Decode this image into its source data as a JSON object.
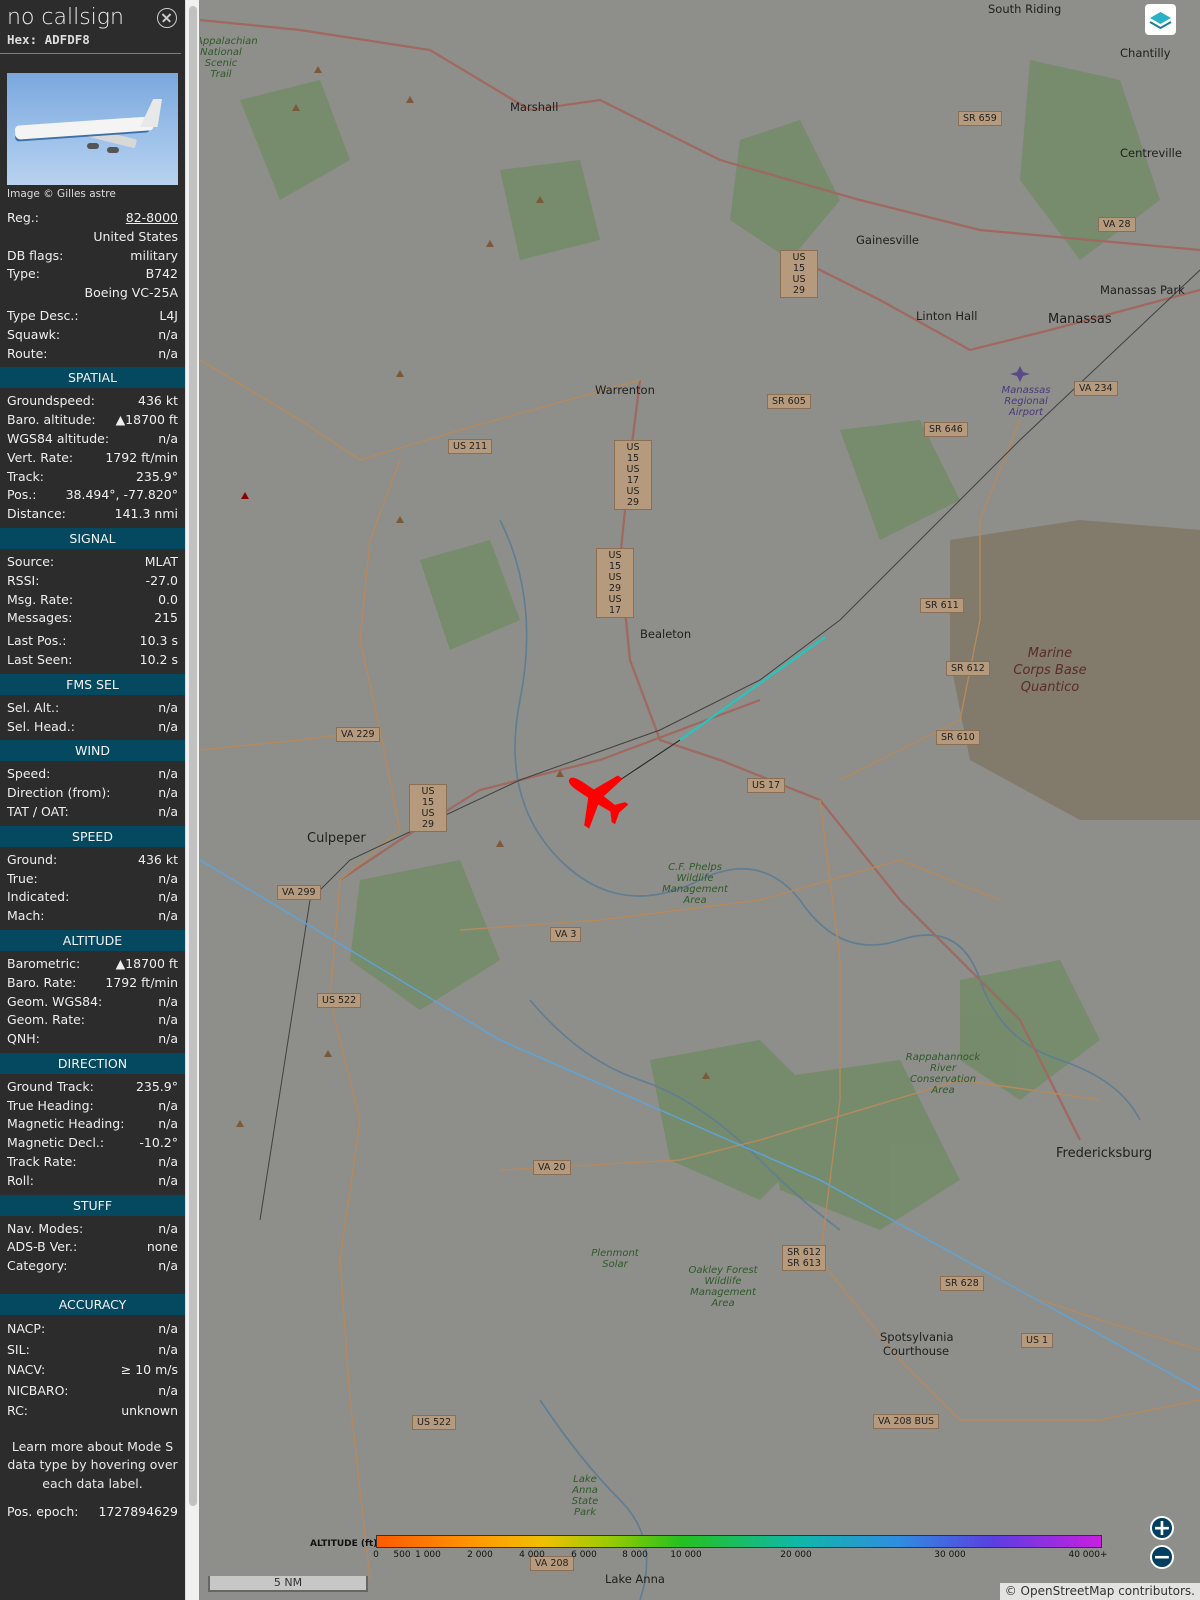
{
  "aircraft": {
    "callsign": "no callsign",
    "hex": "Hex: ADFDF8",
    "photo_credit": "Image © Gilles astre"
  },
  "info": [
    {
      "label": "Reg.:",
      "value": "82-8000"
    },
    {
      "label": "",
      "value": "United States"
    },
    {
      "label": "DB flags:",
      "value": "military"
    },
    {
      "label": "Type:",
      "value": "B742"
    },
    {
      "label": "",
      "value": "Boeing VC-25A"
    },
    {
      "label": "Type Desc.:",
      "value": "L4J"
    },
    {
      "label": "Squawk:",
      "value": "n/a"
    },
    {
      "label": "Route:",
      "value": "n/a"
    }
  ],
  "sections": {
    "spatial": {
      "title": "SPATIAL",
      "rows": [
        {
          "label": "Groundspeed:",
          "value": "436 kt"
        },
        {
          "label": "Baro. altitude:",
          "value": "▲18700 ft"
        },
        {
          "label": "WGS84 altitude:",
          "value": "n/a"
        },
        {
          "label": "Vert. Rate:",
          "value": "1792 ft/min"
        },
        {
          "label": "Track:",
          "value": "235.9°"
        },
        {
          "label": "Pos.:",
          "value": "38.494°, -77.820°"
        },
        {
          "label": "Distance:",
          "value": "141.3 nmi"
        }
      ]
    },
    "signal": {
      "title": "SIGNAL",
      "rows": [
        {
          "label": "Source:",
          "value": "MLAT"
        },
        {
          "label": "RSSI:",
          "value": "-27.0"
        },
        {
          "label": "Msg. Rate:",
          "value": "0.0"
        },
        {
          "label": "Messages:",
          "value": "215"
        },
        {
          "label": "Last Pos.:",
          "value": "10.3 s"
        },
        {
          "label": "Last Seen:",
          "value": "10.2 s"
        }
      ]
    },
    "fms": {
      "title": "FMS SEL",
      "rows": [
        {
          "label": "Sel. Alt.:",
          "value": "n/a"
        },
        {
          "label": "Sel. Head.:",
          "value": "n/a"
        }
      ]
    },
    "wind": {
      "title": "WIND",
      "rows": [
        {
          "label": "Speed:",
          "value": "n/a"
        },
        {
          "label": "Direction (from):",
          "value": "n/a"
        },
        {
          "label": "TAT / OAT:",
          "value": "n/a"
        }
      ]
    },
    "speed": {
      "title": "SPEED",
      "rows": [
        {
          "label": "Ground:",
          "value": "436 kt"
        },
        {
          "label": "True:",
          "value": "n/a"
        },
        {
          "label": "Indicated:",
          "value": "n/a"
        },
        {
          "label": "Mach:",
          "value": "n/a"
        }
      ]
    },
    "altitude": {
      "title": "ALTITUDE",
      "rows": [
        {
          "label": "Barometric:",
          "value": "▲18700 ft"
        },
        {
          "label": "Baro. Rate:",
          "value": "1792 ft/min"
        },
        {
          "label": "Geom. WGS84:",
          "value": "n/a"
        },
        {
          "label": "Geom. Rate:",
          "value": "n/a"
        },
        {
          "label": "QNH:",
          "value": "n/a"
        }
      ]
    },
    "direction": {
      "title": "DIRECTION",
      "rows": [
        {
          "label": "Ground Track:",
          "value": "235.9°"
        },
        {
          "label": "True Heading:",
          "value": "n/a"
        },
        {
          "label": "Magnetic Heading:",
          "value": "n/a"
        },
        {
          "label": "Magnetic Decl.:",
          "value": "-10.2°"
        },
        {
          "label": "Track Rate:",
          "value": "n/a"
        },
        {
          "label": "Roll:",
          "value": "n/a"
        }
      ]
    },
    "stuff": {
      "title": "STUFF",
      "rows": [
        {
          "label": "Nav. Modes:",
          "value": "n/a"
        },
        {
          "label": "ADS-B Ver.:",
          "value": "none"
        },
        {
          "label": "Category:",
          "value": "n/a"
        }
      ]
    },
    "accuracy": {
      "title": "ACCURACY",
      "rows": [
        {
          "label": "NACP:",
          "value": "n/a"
        },
        {
          "label": "SIL:",
          "value": "n/a"
        },
        {
          "label": "NACV:",
          "value": "≥ 10 m/s"
        },
        {
          "label": "NICBARO:",
          "value": "n/a"
        },
        {
          "label": "RC:",
          "value": "unknown"
        }
      ]
    }
  },
  "note": "Learn more about Mode S data type by hovering over each data label.",
  "pos_epoch": {
    "label": "Pos. epoch:",
    "value": "1727894629"
  },
  "map": {
    "towns": [
      {
        "name": "South Riding"
      },
      {
        "name": "Chantilly"
      },
      {
        "name": "Centreville"
      },
      {
        "name": "Marshall"
      },
      {
        "name": "Gainesville"
      },
      {
        "name": "Manassas Park"
      },
      {
        "name": "Linton Hall"
      },
      {
        "name": "Manassas"
      },
      {
        "name": "Warrenton"
      },
      {
        "name": "Bealeton"
      },
      {
        "name": "Culpeper"
      },
      {
        "name": "Fredericksburg"
      },
      {
        "name": "Spotsylvania Courthouse"
      },
      {
        "name": "Lake Anna"
      }
    ],
    "shields": [
      "SR 659",
      "VA 28",
      "US 15 US 29",
      "SR 605",
      "SR 646",
      "VA 234",
      "US 211",
      "US 15 US 17 US 29",
      "US 15 US 29 US 17",
      "SR 611",
      "SR 612",
      "SR 610",
      "VA 229",
      "US 15 US 29",
      "US 17",
      "VA 299",
      "VA 3",
      "US 522",
      "VA 20",
      "SR 612 SR 613",
      "SR 628",
      "US 1",
      "VA 208 BUS",
      "US 522",
      "VA 208"
    ],
    "areas": [
      "Marine Corps Base Quantico",
      "C.F. Phelps Wildlife Management Area",
      "Rappahannock River Conservation Area",
      "Oakley Forest Wildlife Management Area",
      "Plenmont Solar",
      "Lake Anna State Park",
      "Manassas Regional Airport",
      "Appalachian National Scenic Trail"
    ],
    "scale": "5 NM",
    "attribution": "© OpenStreetMap contributors.",
    "legend_title": "ALTITUDE (ft)",
    "legend_ticks": [
      "0",
      "500",
      "1 000",
      "2 000",
      "4 000",
      "6 000",
      "8 000",
      "10 000",
      "20 000",
      "30 000",
      "40 000+"
    ],
    "trail_color": "#22c7c0",
    "aircraft_color": "#ff0000"
  }
}
